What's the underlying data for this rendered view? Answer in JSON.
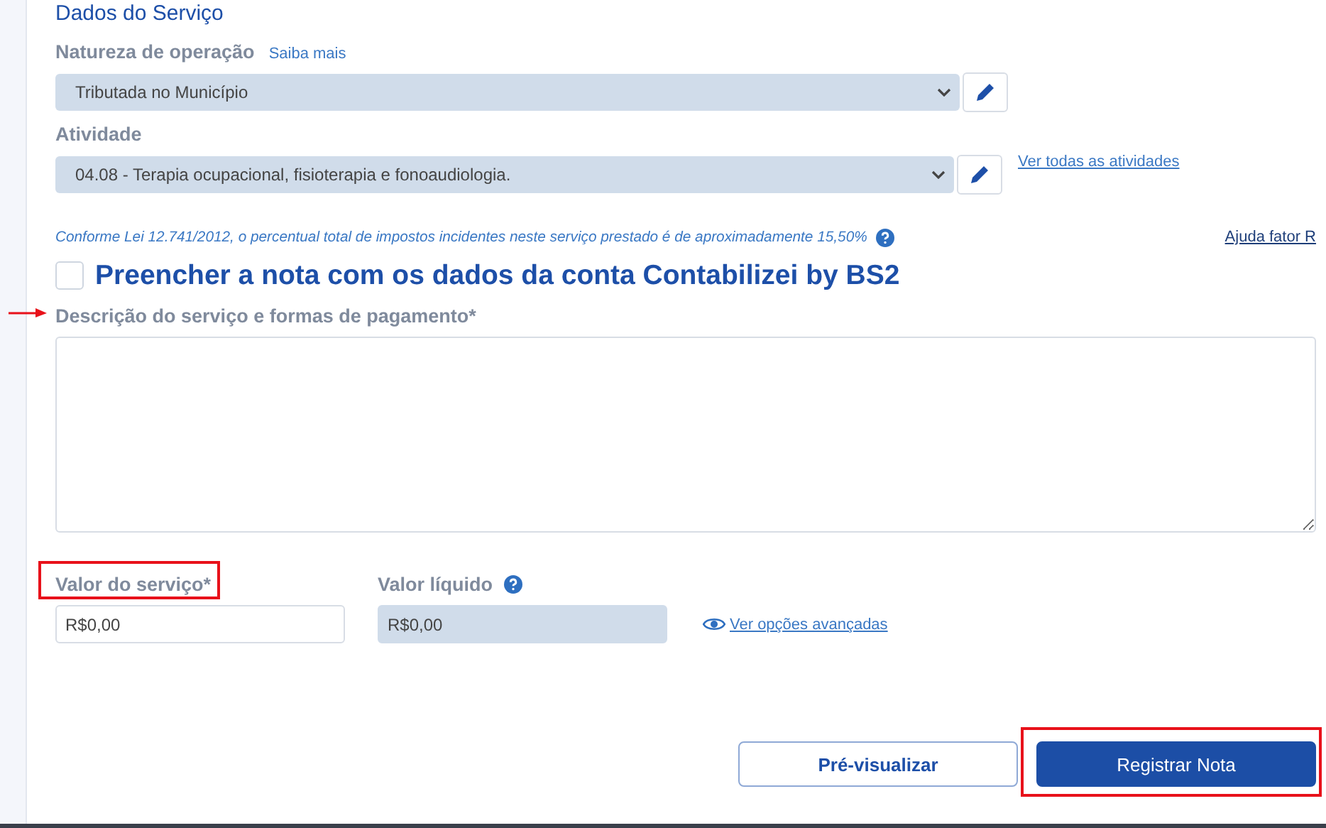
{
  "section_title": "Dados do Serviço",
  "natureza": {
    "label": "Natureza de operação",
    "help_link": "Saiba mais",
    "value": "Tributada no Município"
  },
  "atividade": {
    "label": "Atividade",
    "value": "04.08 - Terapia ocupacional, fisioterapia e fonoaudiologia.",
    "link": "Ver todas as atividades"
  },
  "tax_note": "Conforme Lei 12.741/2012, o percentual total de impostos incidentes neste serviço prestado é de aproximadamente 15,50%",
  "help_link": "Ajuda fator R",
  "prefill": {
    "label": "Preencher a nota com os dados da conta Contabilizei by BS2",
    "checked": false
  },
  "descricao": {
    "label": "Descrição do serviço e formas de pagamento*",
    "marked": true
  },
  "valor_servico": {
    "label": "Valor do serviço*",
    "value": "R$0,00",
    "highlighted": true
  },
  "valor_liquido": {
    "label": "Valor líquido",
    "value": "R$0,00"
  },
  "advanced_link": "Ver opções avançadas",
  "buttons": [
    {
      "label": "Pré-visualizar",
      "kind": "secondary",
      "highlighted": false
    },
    {
      "label": "Registrar Nota",
      "kind": "primary",
      "highlighted": true
    }
  ]
}
